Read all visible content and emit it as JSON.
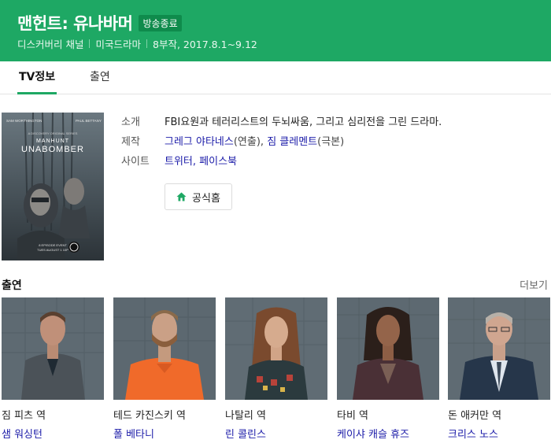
{
  "header": {
    "title": "맨헌트: 유나바머",
    "badge": "방송종료",
    "channel": "디스커버리 채널",
    "genre": "미국드라마",
    "episodes": "8부작, 2017.8.1~9.12",
    "color": "#1ea864"
  },
  "tabs": [
    {
      "label": "TV정보",
      "active": true
    },
    {
      "label": "출연",
      "active": false
    }
  ],
  "poster": {
    "top_left_name": "SAM WORTHINGTON",
    "top_right_name": "PAUL BETTANY",
    "kicker": "A DISCOVERY ORIGINAL SERIES",
    "title_line1": "MANHUNT",
    "title_line2": "UNABOMBER",
    "bottom_line1": "8 EPISODE EVENT",
    "bottom_line2": "TUES AUGUST 1 10P"
  },
  "info": {
    "intro_label": "소개",
    "intro_value": "FBI요원과 테러리스트의 두뇌싸움, 그리고 심리전을 그린 드라마.",
    "production_label": "제작",
    "director_name": "그레그 야타네스",
    "director_role": "(연출), ",
    "writer_name": "짐 클레멘트",
    "writer_role": "(극본)",
    "site_label": "사이트",
    "site_twitter": "트위터",
    "site_sep": ", ",
    "site_facebook": "페이스북"
  },
  "official_home": {
    "label": "공식홈",
    "icon": "home-icon"
  },
  "cast_section": {
    "title": "출연",
    "more": "더보기"
  },
  "cast": [
    {
      "role": "짐 피츠 역",
      "actor": "샘 워싱턴"
    },
    {
      "role": "테드 카진스키 역",
      "actor": "폴 베타니"
    },
    {
      "role": "나탈리 역",
      "actor": "린 콜린스"
    },
    {
      "role": "타비 역",
      "actor": "케이샤 캐슬 휴즈"
    },
    {
      "role": "돈 애커만 역",
      "actor": "크리스 노스"
    }
  ]
}
